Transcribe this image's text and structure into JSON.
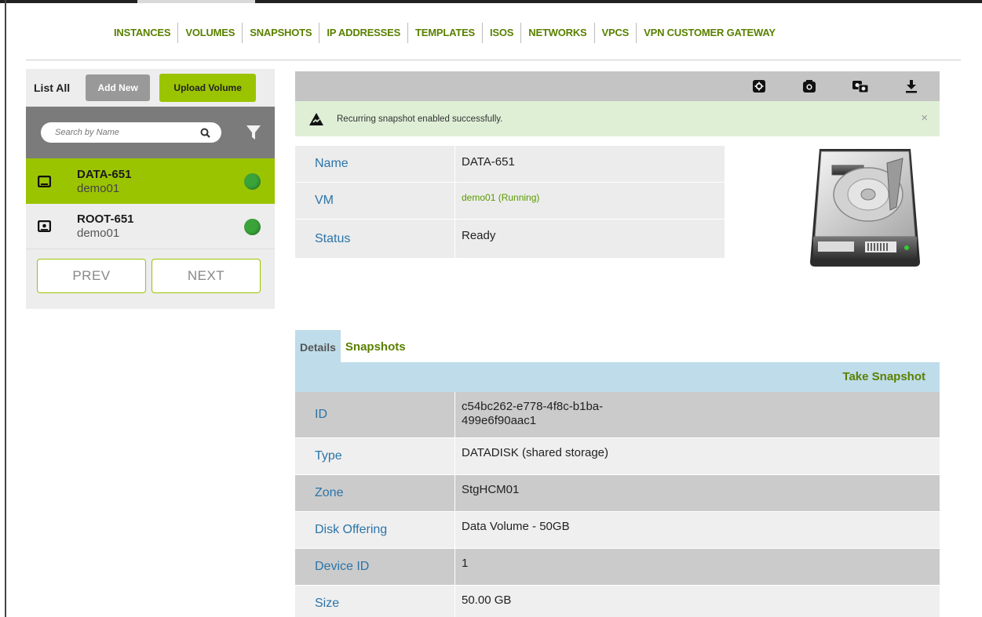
{
  "nav": {
    "tabs": [
      "INSTANCES",
      "VOLUMES",
      "SNAPSHOTS",
      "IP ADDRESSES",
      "TEMPLATES",
      "ISOS",
      "NETWORKS",
      "VPCS",
      "VPN CUSTOMER GATEWAY"
    ],
    "active_tab": "VOLUMES"
  },
  "sidebar": {
    "list_all_label": "List All",
    "add_new_label": "Add New",
    "upload_label": "Upload Volume",
    "search_placeholder": "Search by Name",
    "items": [
      {
        "name": "DATA-651",
        "vm": "demo01",
        "status_color": "#3aa33a",
        "selected": true,
        "icon": "data-disk-icon"
      },
      {
        "name": "ROOT-651",
        "vm": "demo01",
        "status_color": "#3aa33a",
        "selected": false,
        "icon": "root-disk-icon"
      }
    ],
    "prev_label": "PREV",
    "next_label": "NEXT"
  },
  "toolbar": {
    "icons": [
      "settings-icon",
      "camera-icon",
      "recurring-snapshot-icon",
      "download-icon"
    ]
  },
  "notice": {
    "text": "Recurring snapshot enabled successfully.",
    "close": "×"
  },
  "summary": {
    "rows": [
      {
        "label": "Name",
        "value": "DATA-651"
      },
      {
        "label": "VM",
        "value": "demo01 (Running)"
      },
      {
        "label": "Status",
        "value": "Ready"
      }
    ]
  },
  "details": {
    "tab_details": "Details",
    "tab_snapshots": "Snapshots",
    "take_snapshot": "Take Snapshot",
    "rows": [
      {
        "label": "ID",
        "value": "c54bc262-e778-4f8c-b1ba-499e6f90aac1"
      },
      {
        "label": "Type",
        "value": "DATADISK (shared storage)"
      },
      {
        "label": "Zone",
        "value": "StgHCM01"
      },
      {
        "label": "Disk Offering",
        "value": "Data Volume - 50GB"
      },
      {
        "label": "Device ID",
        "value": "1"
      },
      {
        "label": "Size",
        "value": "50.00 GB"
      }
    ]
  },
  "colors": {
    "accent_green": "#9bc400",
    "nav_text": "#5a8000",
    "label_blue": "#2b74a8",
    "notice_bg": "#deefd6"
  }
}
